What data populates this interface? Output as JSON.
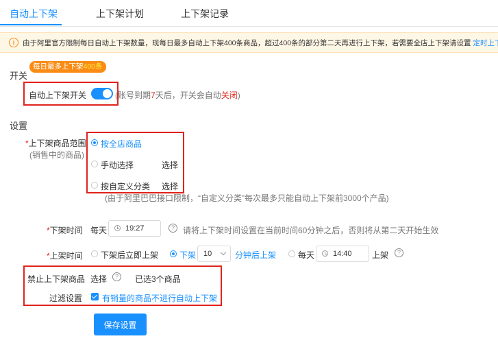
{
  "tabs": [
    {
      "label": "自动上下架"
    },
    {
      "label": "上下架计划"
    },
    {
      "label": "上下架记录"
    }
  ],
  "notice": {
    "icon": "info-icon",
    "text": "由于阿里官方限制每日自动上下架数量，现每日最多自动上下架400条商品，超过400条的部分第二天再进行上下架，若需要全店上下架请设置",
    "link": "定时上下架"
  },
  "switch_section": {
    "title": "开关",
    "badge_prefix": "每日最多上下架",
    "badge_num": "400条",
    "toggle_label": "自动上下架开关",
    "toggle_on": true,
    "hint_pre": "(账号到期",
    "hint_days": "7",
    "hint_mid": "天后，开关会自动",
    "hint_close": "关闭",
    "hint_end": ")"
  },
  "settings": {
    "title": "设置",
    "range_label_star": "*",
    "range_label": "上下架商品范围",
    "range_sublabel": "(销售中的商品)",
    "options": [
      {
        "label": "按全店商品",
        "checked": true
      },
      {
        "label": "手动选择",
        "checked": false,
        "action": "选择"
      },
      {
        "label": "按自定义分类",
        "checked": false,
        "action": "选择"
      }
    ],
    "range_note": "(由于阿里巴巴接口限制，“自定义分类”每次最多只能自动上下架前3000个产品)",
    "offshelf": {
      "star": "*",
      "label": "下架时间",
      "prefix": "每天",
      "time": "19:27",
      "hint": "请将上下架时间设置在当前时间60分钟之后，否则将从第二天开始生效"
    },
    "onshelf": {
      "star": "*",
      "label": "上架时间",
      "opt_immediate": "下架后立即上架",
      "opt_after": "下架",
      "after_minutes": "10",
      "after_suffix": "分钟后上架",
      "opt_daily": "每天",
      "daily_time": "14:40",
      "daily_suffix": "上架",
      "selected": "after"
    },
    "forbid": {
      "label": "禁止上下架商品",
      "action": "选择",
      "selected_text": "已选3个商品"
    },
    "filter": {
      "label": "过滤设置",
      "checkbox_label": "有销量的商品不进行自动上下架",
      "checked": true
    }
  },
  "save_button": "保存设置",
  "colors": {
    "accent": "#1890ff",
    "highlight_box": "#e0231c",
    "badge": "#fa8c16",
    "notice_bg": "#fff7e6"
  }
}
